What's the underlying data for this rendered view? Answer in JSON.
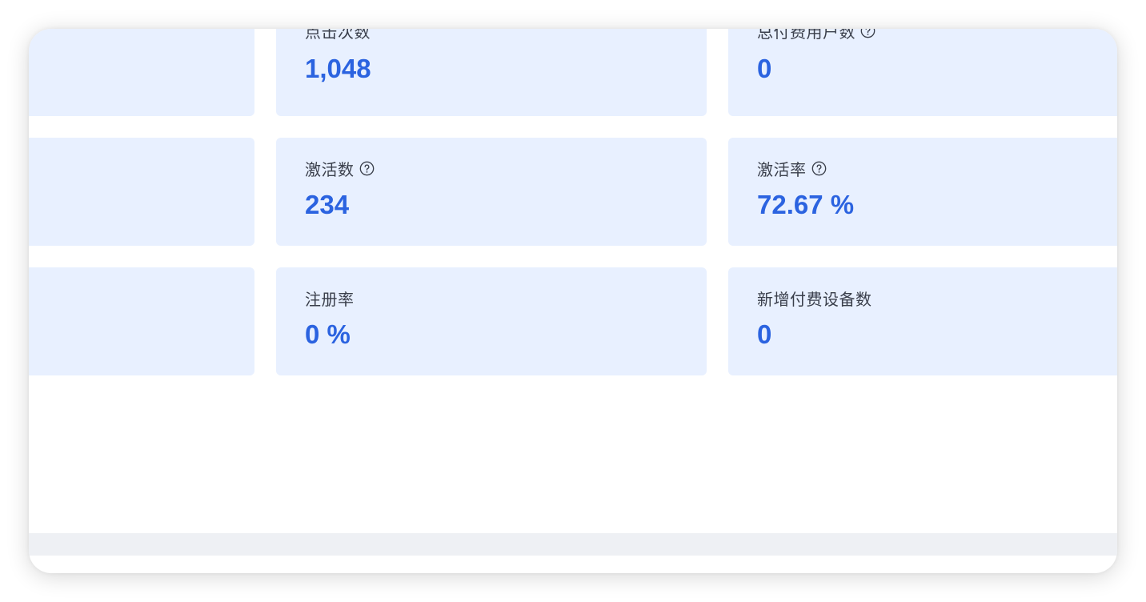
{
  "colors": {
    "card_bg": "#e8f0ff",
    "value_blue": "#2b63e0",
    "label_text": "#3a3f4b",
    "footer_bg": "#eef0f4"
  },
  "stats": {
    "row1": {
      "mid": {
        "label": "点击次数",
        "value": "1,048",
        "help": false
      },
      "right": {
        "label": "总付费用户数",
        "value": "0",
        "help": true
      }
    },
    "row2": {
      "mid": {
        "label": "激活数",
        "value": "234",
        "help": true
      },
      "right": {
        "label": "激活率",
        "value": "72.67 %",
        "help": true
      }
    },
    "row3": {
      "mid": {
        "label": "注册率",
        "value": "0 %",
        "help": false
      },
      "right": {
        "label": "新增付费设备数",
        "value": "0",
        "help": false
      }
    }
  },
  "icons": {
    "help": "question-circle-icon"
  }
}
